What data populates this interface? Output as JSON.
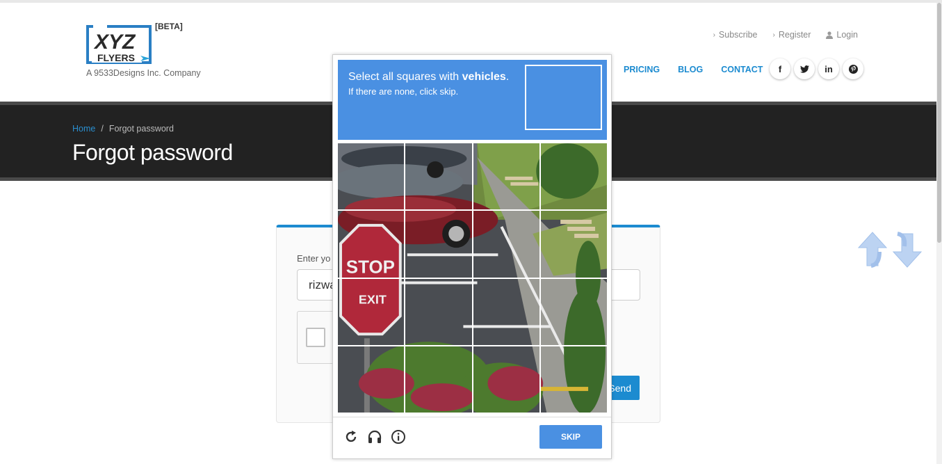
{
  "header": {
    "logo_text": "XYZ",
    "logo_sub": "FLYERS",
    "beta_badge": "[BETA]",
    "company": "A 9533Designs Inc. Company",
    "top_links": [
      {
        "label": "Subscribe",
        "icon": "chevron-right-icon"
      },
      {
        "label": "Register",
        "icon": "chevron-right-icon"
      },
      {
        "label": "Login",
        "icon": "user-icon"
      }
    ],
    "nav": [
      "PRICING",
      "BLOG",
      "CONTACT"
    ],
    "social": [
      {
        "icon": "facebook-icon",
        "glyph": "f"
      },
      {
        "icon": "twitter-icon",
        "glyph": "t"
      },
      {
        "icon": "linkedin-icon",
        "glyph": "in"
      },
      {
        "icon": "pinterest-icon",
        "glyph": "p"
      }
    ]
  },
  "banner": {
    "breadcrumb_home": "Home",
    "breadcrumb_sep": "/",
    "breadcrumb_current": "Forgot password",
    "title": "Forgot password"
  },
  "form": {
    "label": "Enter yo",
    "email_value": "rizwa",
    "send_label": "Send"
  },
  "captcha": {
    "instruction_prefix": "Select all squares with",
    "instruction_target": "vehicles",
    "instruction_suffix": ".",
    "subtext": "If there are none, click skip.",
    "skip_label": "SKIP",
    "footer_icons": [
      "reload-icon",
      "headphones-icon",
      "info-icon"
    ],
    "accent_color": "#4a90e2"
  }
}
